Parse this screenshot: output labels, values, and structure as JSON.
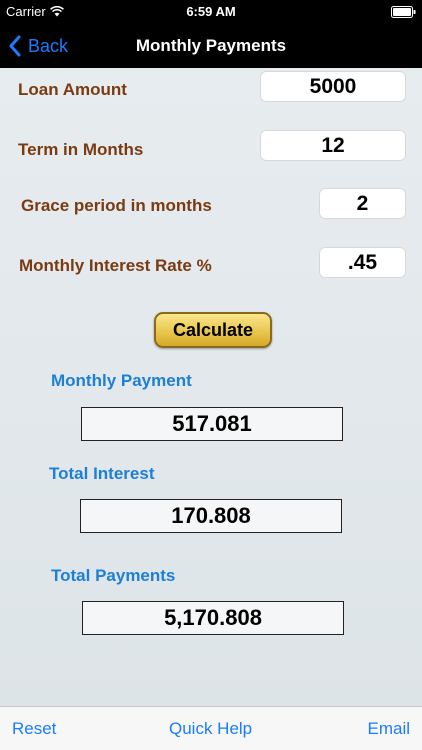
{
  "status_bar": {
    "carrier": "Carrier",
    "time": "6:59 AM"
  },
  "nav": {
    "back_label": "Back",
    "title": "Monthly Payments"
  },
  "form": {
    "loan_amount": {
      "label": "Loan Amount",
      "value": "5000"
    },
    "term_months": {
      "label": "Term in Months",
      "value": "12"
    },
    "grace_period": {
      "label": "Grace period in months",
      "value": "2"
    },
    "interest_rate": {
      "label": "Monthly Interest Rate %",
      "value": ".45"
    }
  },
  "calculate_label": "Calculate",
  "results": {
    "monthly_payment": {
      "label": "Monthly Payment",
      "value": "517.081"
    },
    "total_interest": {
      "label": "Total Interest",
      "value": "170.808"
    },
    "total_payments": {
      "label": "Total Payments",
      "value": "5,170.808"
    }
  },
  "toolbar": {
    "reset": "Reset",
    "quick_help": "Quick Help",
    "email": "Email"
  },
  "colors": {
    "accent": "#1a7cff",
    "label_brown": "#7a3b12",
    "result_blue": "#1e7fd6",
    "button_gold": "#e9c74e"
  }
}
